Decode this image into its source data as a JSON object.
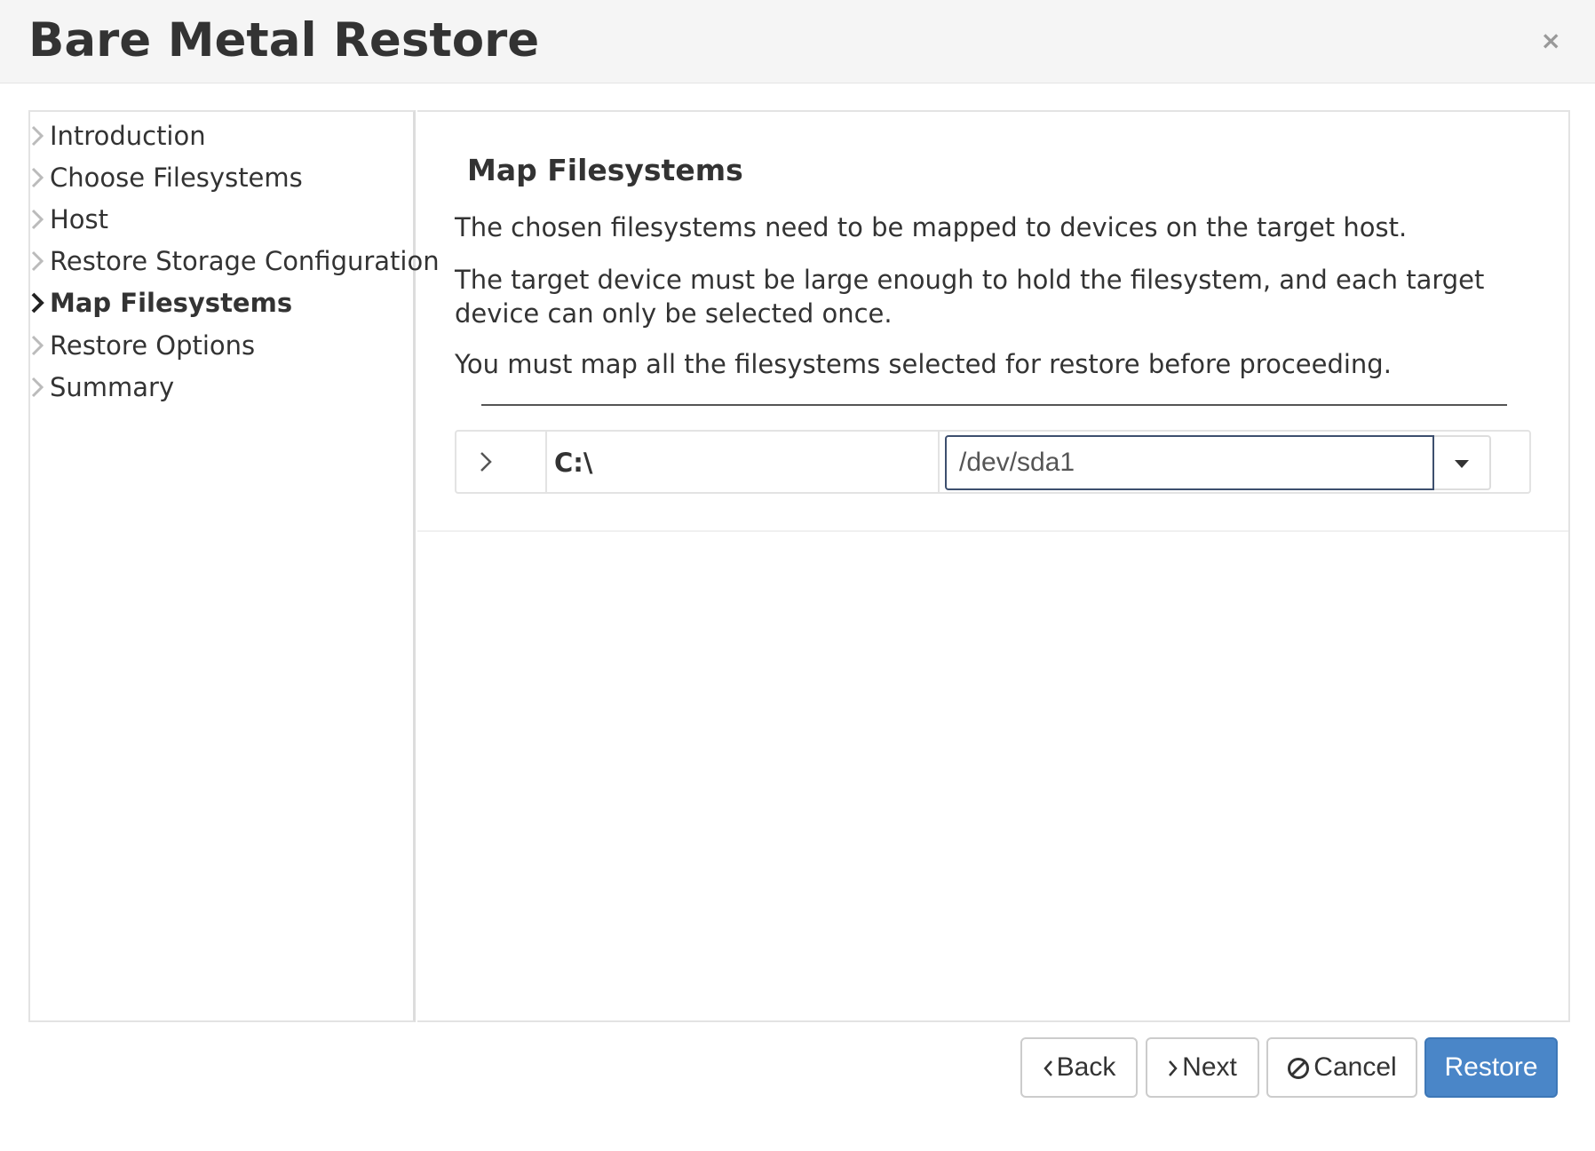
{
  "dialog": {
    "title": "Bare Metal Restore",
    "close_label": "×"
  },
  "sidebar": {
    "items": [
      {
        "label": "Introduction",
        "active": false
      },
      {
        "label": "Choose Filesystems",
        "active": false
      },
      {
        "label": "Host",
        "active": false
      },
      {
        "label": "Restore Storage Configuration",
        "active": false
      },
      {
        "label": "Map Filesystems",
        "active": true
      },
      {
        "label": "Restore Options",
        "active": false
      },
      {
        "label": "Summary",
        "active": false
      }
    ]
  },
  "content": {
    "heading": "Map Filesystems",
    "paragraphs": [
      "The chosen filesystems need to be mapped to devices on the target host.",
      "The target device must be large enough to hold the filesystem, and each target device can only be selected once.",
      "You must map all the filesystems selected for restore before proceeding."
    ],
    "mappings": [
      {
        "filesystem": "C:\\",
        "device": "/dev/sda1"
      }
    ]
  },
  "footer": {
    "back_label": "Back",
    "next_label": "Next",
    "cancel_label": "Cancel",
    "restore_label": "Restore"
  },
  "colors": {
    "primary": "#4a86c8",
    "header_bg": "#f5f5f5",
    "input_focus_border": "#3d4f6e"
  },
  "icons": {
    "close": "close-icon",
    "nav_chevron": "chevron-right-icon",
    "row_expand": "chevron-right-icon",
    "dropdown": "caret-down-icon",
    "back": "chevron-left-icon",
    "next": "chevron-right-icon",
    "cancel": "ban-icon"
  }
}
